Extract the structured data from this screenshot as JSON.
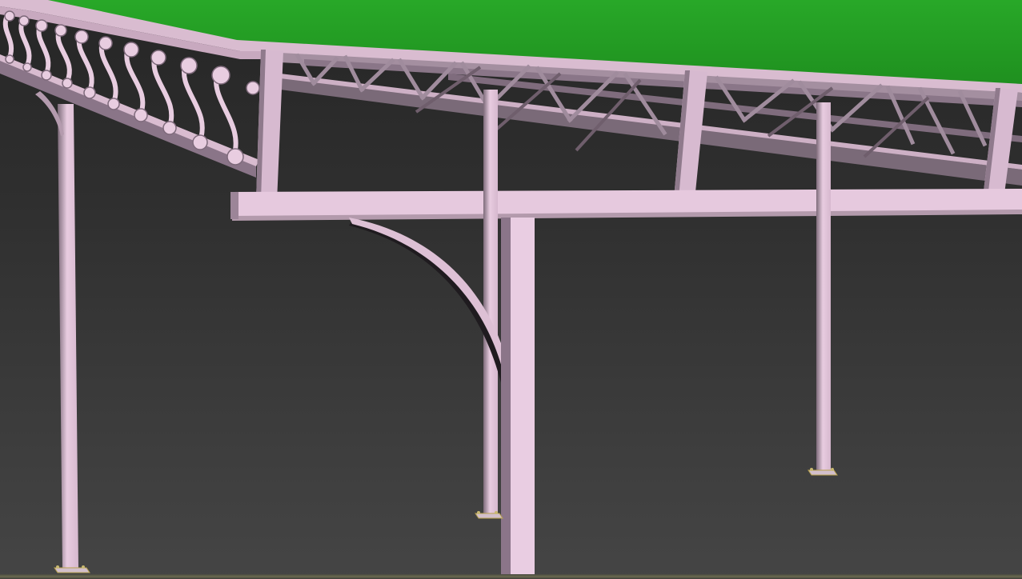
{
  "viewport": {
    "background_top": "#262626",
    "background_bottom": "#454545"
  },
  "scene": {
    "subject": "steel-canopy-3d-model",
    "colors": {
      "roof_panel": "#23a023",
      "roof_panel_dark": "#1b801b",
      "steel_light": "#e6c8de",
      "steel_mid": "#c9a9c1",
      "steel_dark": "#7a6a78",
      "steel_shadow": "#5b4f5a",
      "base_plate": "#c8b870"
    },
    "icons": [
      "scroll-railing-icon",
      "truss-icon",
      "column-icon",
      "curved-brace-icon"
    ]
  }
}
